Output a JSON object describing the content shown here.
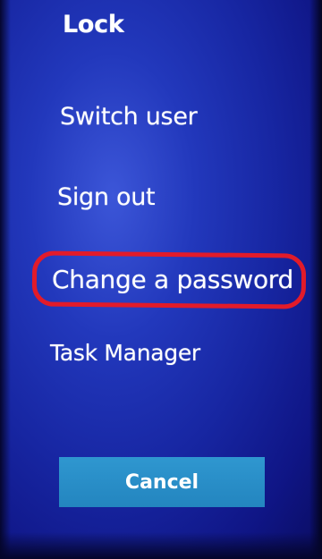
{
  "menu": {
    "items": [
      {
        "id": "lock",
        "label": "Lock"
      },
      {
        "id": "switch-user",
        "label": "Switch user"
      },
      {
        "id": "sign-out",
        "label": "Sign out"
      },
      {
        "id": "change-password",
        "label": "Change a password",
        "highlighted": true
      },
      {
        "id": "task-manager",
        "label": "Task Manager"
      }
    ]
  },
  "cancel_button": {
    "label": "Cancel"
  },
  "colors": {
    "background": "#1a2ca8",
    "text": "#ffffff",
    "cancel_button": "#2a8fc9",
    "highlight_ring": "#e21b2a"
  }
}
